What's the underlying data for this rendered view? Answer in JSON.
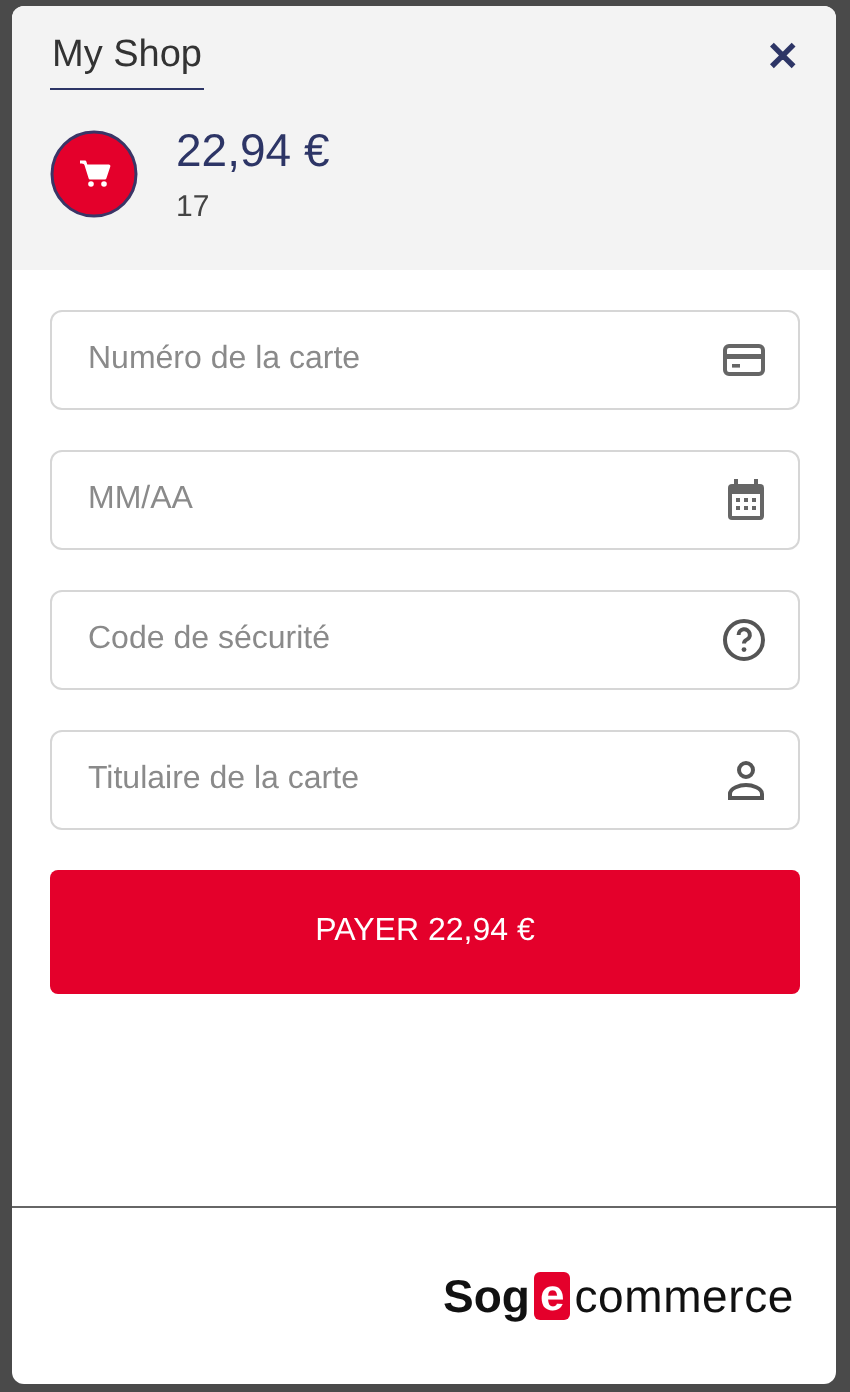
{
  "header": {
    "title": "My Shop",
    "close": "✕",
    "amount": "22,94 €",
    "reference": "17"
  },
  "fields": [
    {
      "kind": "card",
      "placeholder": "Numéro de la carte"
    },
    {
      "kind": "date",
      "placeholder": "MM/AA"
    },
    {
      "kind": "help",
      "placeholder": "Code de sécurité"
    },
    {
      "kind": "person",
      "placeholder": "Titulaire de la carte"
    }
  ],
  "pay_button": "PAYER 22,94 €",
  "logo": {
    "prefix": "Sog",
    "mark": "e",
    "suffix": "commerce"
  }
}
